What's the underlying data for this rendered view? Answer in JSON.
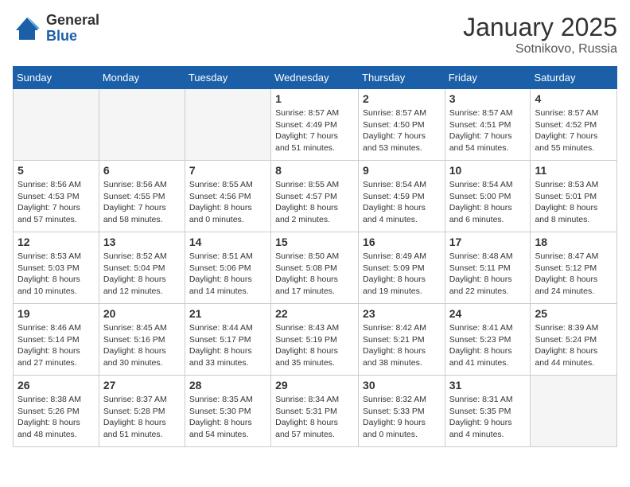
{
  "header": {
    "logo_general": "General",
    "logo_blue": "Blue",
    "month_title": "January 2025",
    "location": "Sotnikovo, Russia"
  },
  "days_of_week": [
    "Sunday",
    "Monday",
    "Tuesday",
    "Wednesday",
    "Thursday",
    "Friday",
    "Saturday"
  ],
  "weeks": [
    [
      {
        "day": "",
        "info": ""
      },
      {
        "day": "",
        "info": ""
      },
      {
        "day": "",
        "info": ""
      },
      {
        "day": "1",
        "info": "Sunrise: 8:57 AM\nSunset: 4:49 PM\nDaylight: 7 hours\nand 51 minutes."
      },
      {
        "day": "2",
        "info": "Sunrise: 8:57 AM\nSunset: 4:50 PM\nDaylight: 7 hours\nand 53 minutes."
      },
      {
        "day": "3",
        "info": "Sunrise: 8:57 AM\nSunset: 4:51 PM\nDaylight: 7 hours\nand 54 minutes."
      },
      {
        "day": "4",
        "info": "Sunrise: 8:57 AM\nSunset: 4:52 PM\nDaylight: 7 hours\nand 55 minutes."
      }
    ],
    [
      {
        "day": "5",
        "info": "Sunrise: 8:56 AM\nSunset: 4:53 PM\nDaylight: 7 hours\nand 57 minutes."
      },
      {
        "day": "6",
        "info": "Sunrise: 8:56 AM\nSunset: 4:55 PM\nDaylight: 7 hours\nand 58 minutes."
      },
      {
        "day": "7",
        "info": "Sunrise: 8:55 AM\nSunset: 4:56 PM\nDaylight: 8 hours\nand 0 minutes."
      },
      {
        "day": "8",
        "info": "Sunrise: 8:55 AM\nSunset: 4:57 PM\nDaylight: 8 hours\nand 2 minutes."
      },
      {
        "day": "9",
        "info": "Sunrise: 8:54 AM\nSunset: 4:59 PM\nDaylight: 8 hours\nand 4 minutes."
      },
      {
        "day": "10",
        "info": "Sunrise: 8:54 AM\nSunset: 5:00 PM\nDaylight: 8 hours\nand 6 minutes."
      },
      {
        "day": "11",
        "info": "Sunrise: 8:53 AM\nSunset: 5:01 PM\nDaylight: 8 hours\nand 8 minutes."
      }
    ],
    [
      {
        "day": "12",
        "info": "Sunrise: 8:53 AM\nSunset: 5:03 PM\nDaylight: 8 hours\nand 10 minutes."
      },
      {
        "day": "13",
        "info": "Sunrise: 8:52 AM\nSunset: 5:04 PM\nDaylight: 8 hours\nand 12 minutes."
      },
      {
        "day": "14",
        "info": "Sunrise: 8:51 AM\nSunset: 5:06 PM\nDaylight: 8 hours\nand 14 minutes."
      },
      {
        "day": "15",
        "info": "Sunrise: 8:50 AM\nSunset: 5:08 PM\nDaylight: 8 hours\nand 17 minutes."
      },
      {
        "day": "16",
        "info": "Sunrise: 8:49 AM\nSunset: 5:09 PM\nDaylight: 8 hours\nand 19 minutes."
      },
      {
        "day": "17",
        "info": "Sunrise: 8:48 AM\nSunset: 5:11 PM\nDaylight: 8 hours\nand 22 minutes."
      },
      {
        "day": "18",
        "info": "Sunrise: 8:47 AM\nSunset: 5:12 PM\nDaylight: 8 hours\nand 24 minutes."
      }
    ],
    [
      {
        "day": "19",
        "info": "Sunrise: 8:46 AM\nSunset: 5:14 PM\nDaylight: 8 hours\nand 27 minutes."
      },
      {
        "day": "20",
        "info": "Sunrise: 8:45 AM\nSunset: 5:16 PM\nDaylight: 8 hours\nand 30 minutes."
      },
      {
        "day": "21",
        "info": "Sunrise: 8:44 AM\nSunset: 5:17 PM\nDaylight: 8 hours\nand 33 minutes."
      },
      {
        "day": "22",
        "info": "Sunrise: 8:43 AM\nSunset: 5:19 PM\nDaylight: 8 hours\nand 35 minutes."
      },
      {
        "day": "23",
        "info": "Sunrise: 8:42 AM\nSunset: 5:21 PM\nDaylight: 8 hours\nand 38 minutes."
      },
      {
        "day": "24",
        "info": "Sunrise: 8:41 AM\nSunset: 5:23 PM\nDaylight: 8 hours\nand 41 minutes."
      },
      {
        "day": "25",
        "info": "Sunrise: 8:39 AM\nSunset: 5:24 PM\nDaylight: 8 hours\nand 44 minutes."
      }
    ],
    [
      {
        "day": "26",
        "info": "Sunrise: 8:38 AM\nSunset: 5:26 PM\nDaylight: 8 hours\nand 48 minutes."
      },
      {
        "day": "27",
        "info": "Sunrise: 8:37 AM\nSunset: 5:28 PM\nDaylight: 8 hours\nand 51 minutes."
      },
      {
        "day": "28",
        "info": "Sunrise: 8:35 AM\nSunset: 5:30 PM\nDaylight: 8 hours\nand 54 minutes."
      },
      {
        "day": "29",
        "info": "Sunrise: 8:34 AM\nSunset: 5:31 PM\nDaylight: 8 hours\nand 57 minutes."
      },
      {
        "day": "30",
        "info": "Sunrise: 8:32 AM\nSunset: 5:33 PM\nDaylight: 9 hours\nand 0 minutes."
      },
      {
        "day": "31",
        "info": "Sunrise: 8:31 AM\nSunset: 5:35 PM\nDaylight: 9 hours\nand 4 minutes."
      },
      {
        "day": "",
        "info": ""
      }
    ]
  ]
}
